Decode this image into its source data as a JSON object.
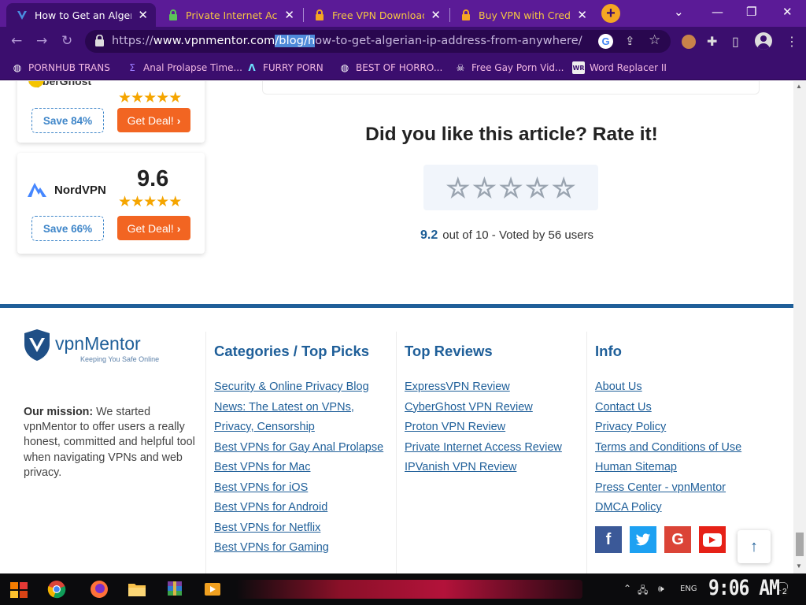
{
  "browser": {
    "tabs": [
      {
        "title": "How to Get an Algeria",
        "close": "✕",
        "active": true
      },
      {
        "title": "Private Internet Acce",
        "close": "✕",
        "active": false
      },
      {
        "title": "Free VPN Download f",
        "close": "✕",
        "active": false
      },
      {
        "title": "Buy VPN with Credit",
        "close": "✕",
        "active": false
      }
    ],
    "new_tab": "+",
    "url": {
      "scheme": "https://",
      "host": "www.vpnmentor.com",
      "selected": "/blog/h",
      "rest": "ow-to-get-algerian-ip-address-from-anywhere/"
    },
    "bookmarks": [
      {
        "label": "PORNHUB TRANS",
        "icon": "globe-icon"
      },
      {
        "label": "Anal Prolapse Time...",
        "icon": "bookmark-icon"
      },
      {
        "label": "FURRY PORN",
        "icon": "a-logo-icon"
      },
      {
        "label": "BEST OF HORRO...",
        "icon": "globe-icon"
      },
      {
        "label": "Free Gay Porn Vid...",
        "icon": "skull-icon"
      },
      {
        "label": "Word Replacer II",
        "icon": "wr-icon"
      }
    ]
  },
  "sidebar_cards": [
    {
      "brand": "CyberGhost",
      "save": "Save 84%",
      "deal": "Get Deal!"
    },
    {
      "brand": "NordVPN",
      "score": "9.6",
      "save": "Save 66%",
      "deal": "Get Deal!"
    }
  ],
  "rating": {
    "title": "Did you like this article? Rate it!",
    "score": "9.2",
    "summary": "out of 10 - Voted by 56 users",
    "stars": [
      "☆",
      "☆",
      "☆",
      "☆",
      "☆"
    ]
  },
  "footer": {
    "logo": {
      "name": "vpnMentor",
      "tagline": "Keeping You Safe Online"
    },
    "mission_label": "Our mission:",
    "mission_text": "We started vpnMentor to offer users a really honest, committed and helpful tool when navigating VPNs and web privacy.",
    "columns": [
      {
        "heading": "Categories / Top Picks",
        "links": [
          "Security & Online Privacy Blog",
          "News: The Latest on VPNs, Privacy, Censorship",
          "Best VPNs for Gay Anal Prolapse",
          "Best VPNs for Mac",
          "Best VPNs for iOS",
          "Best VPNs for Android",
          "Best VPNs for Netflix",
          "Best VPNs for Gaming"
        ]
      },
      {
        "heading": "Top Reviews",
        "links": [
          "ExpressVPN Review",
          "CyberGhost VPN Review",
          "Proton VPN Review",
          "Private Internet Access Review",
          "IPVanish VPN Review"
        ]
      },
      {
        "heading": "Info",
        "links": [
          "About Us",
          "Contact Us",
          "Privacy Policy",
          "Terms and Conditions of Use",
          "Human Sitemap",
          "Press Center - vpnMentor",
          "DMCA Policy"
        ]
      }
    ],
    "social": [
      {
        "name": "facebook",
        "glyph": "f",
        "color": "#3b5998"
      },
      {
        "name": "twitter",
        "glyph": "t",
        "color": "#1da1f2"
      },
      {
        "name": "google",
        "glyph": "G",
        "color": "#db4437"
      },
      {
        "name": "youtube",
        "glyph": "▶",
        "color": "#e62117"
      }
    ],
    "to_top": "↑"
  },
  "taskbar": {
    "lang": "ENG",
    "time": "9:06 AM",
    "notifications": "2"
  },
  "colors": {
    "brand_blue": "#1f5f99",
    "deal_orange": "#f26522",
    "browser_purple": "#3b0e6e"
  }
}
